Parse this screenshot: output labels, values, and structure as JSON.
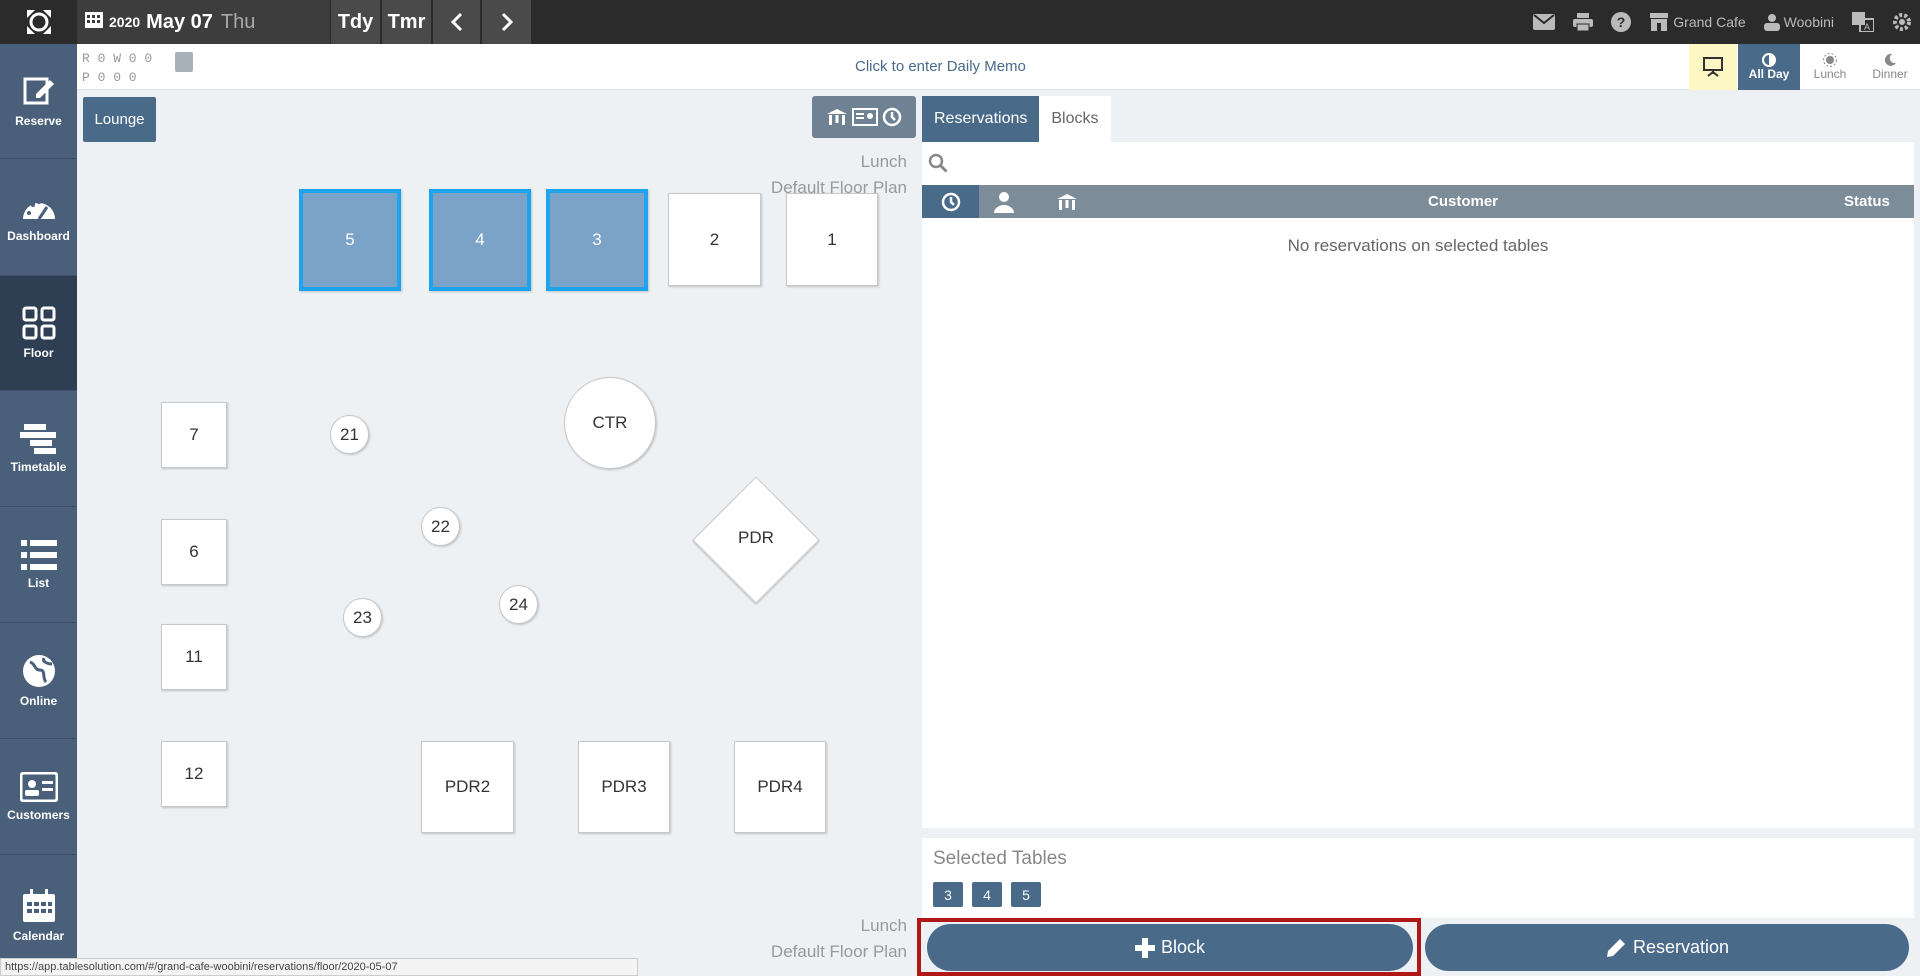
{
  "topbar": {
    "year": "2020",
    "month_day": "May 07",
    "weekday": "Thu",
    "today_label": "Tdy",
    "tomorrow_label": "Tmr",
    "venue": "Grand Cafe",
    "user": "Woobini"
  },
  "sidebar": {
    "items": [
      {
        "label": "Reserve",
        "icon": "edit-icon"
      },
      {
        "label": "Dashboard",
        "icon": "gauge-icon"
      },
      {
        "label": "Floor",
        "icon": "grid-icon"
      },
      {
        "label": "Timetable",
        "icon": "timetable-icon"
      },
      {
        "label": "List",
        "icon": "list-icon"
      },
      {
        "label": "Online",
        "icon": "globe-icon"
      },
      {
        "label": "Customers",
        "icon": "id-card-icon"
      },
      {
        "label": "Calendar",
        "icon": "calendar-icon"
      }
    ]
  },
  "stats": {
    "row1": "R 0 W 0  0",
    "row2": "P 0   0   0"
  },
  "memo": "Click to enter Daily Memo",
  "shifts": {
    "all_day": "All Day",
    "lunch": "Lunch",
    "dinner": "Dinner"
  },
  "floor": {
    "area_tab": "Lounge",
    "shift_label": "Lunch",
    "plan_label": "Default Floor Plan",
    "tables": [
      "5",
      "4",
      "3",
      "2",
      "1",
      "7",
      "6",
      "11",
      "12",
      "21",
      "22",
      "23",
      "24",
      "CTR",
      "PDR",
      "PDR2",
      "PDR3",
      "PDR4"
    ],
    "selected": [
      "5",
      "4",
      "3"
    ]
  },
  "panel": {
    "tab_reservations": "Reservations",
    "tab_blocks": "Blocks",
    "col_customer": "Customer",
    "col_status": "Status",
    "empty_message": "No reservations on selected tables",
    "selected_title": "Selected Tables",
    "selected_tables": [
      "3",
      "4",
      "5"
    ]
  },
  "actions": {
    "block_label": "Block",
    "reservation_label": "Reservation"
  },
  "status_url": "https://app.tablesolution.com/#/grand-cafe-woobini/reservations/floor/2020-05-07",
  "colors": {
    "accent": "#4a6a8a",
    "sidebar": "#4a5f7a",
    "selected_border": "#1ea3f0",
    "highlight": "#b01818"
  }
}
